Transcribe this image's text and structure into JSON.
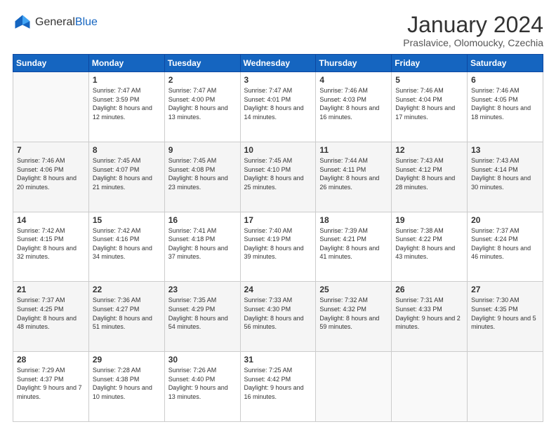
{
  "header": {
    "logo_general": "General",
    "logo_blue": "Blue",
    "month_title": "January 2024",
    "location": "Praslavice, Olomoucky, Czechia"
  },
  "weekdays": [
    "Sunday",
    "Monday",
    "Tuesday",
    "Wednesday",
    "Thursday",
    "Friday",
    "Saturday"
  ],
  "weeks": [
    [
      {
        "day": "",
        "sunrise": "",
        "sunset": "",
        "daylight": ""
      },
      {
        "day": "1",
        "sunrise": "Sunrise: 7:47 AM",
        "sunset": "Sunset: 3:59 PM",
        "daylight": "Daylight: 8 hours and 12 minutes."
      },
      {
        "day": "2",
        "sunrise": "Sunrise: 7:47 AM",
        "sunset": "Sunset: 4:00 PM",
        "daylight": "Daylight: 8 hours and 13 minutes."
      },
      {
        "day": "3",
        "sunrise": "Sunrise: 7:47 AM",
        "sunset": "Sunset: 4:01 PM",
        "daylight": "Daylight: 8 hours and 14 minutes."
      },
      {
        "day": "4",
        "sunrise": "Sunrise: 7:46 AM",
        "sunset": "Sunset: 4:03 PM",
        "daylight": "Daylight: 8 hours and 16 minutes."
      },
      {
        "day": "5",
        "sunrise": "Sunrise: 7:46 AM",
        "sunset": "Sunset: 4:04 PM",
        "daylight": "Daylight: 8 hours and 17 minutes."
      },
      {
        "day": "6",
        "sunrise": "Sunrise: 7:46 AM",
        "sunset": "Sunset: 4:05 PM",
        "daylight": "Daylight: 8 hours and 18 minutes."
      }
    ],
    [
      {
        "day": "7",
        "sunrise": "Sunrise: 7:46 AM",
        "sunset": "Sunset: 4:06 PM",
        "daylight": "Daylight: 8 hours and 20 minutes."
      },
      {
        "day": "8",
        "sunrise": "Sunrise: 7:45 AM",
        "sunset": "Sunset: 4:07 PM",
        "daylight": "Daylight: 8 hours and 21 minutes."
      },
      {
        "day": "9",
        "sunrise": "Sunrise: 7:45 AM",
        "sunset": "Sunset: 4:08 PM",
        "daylight": "Daylight: 8 hours and 23 minutes."
      },
      {
        "day": "10",
        "sunrise": "Sunrise: 7:45 AM",
        "sunset": "Sunset: 4:10 PM",
        "daylight": "Daylight: 8 hours and 25 minutes."
      },
      {
        "day": "11",
        "sunrise": "Sunrise: 7:44 AM",
        "sunset": "Sunset: 4:11 PM",
        "daylight": "Daylight: 8 hours and 26 minutes."
      },
      {
        "day": "12",
        "sunrise": "Sunrise: 7:43 AM",
        "sunset": "Sunset: 4:12 PM",
        "daylight": "Daylight: 8 hours and 28 minutes."
      },
      {
        "day": "13",
        "sunrise": "Sunrise: 7:43 AM",
        "sunset": "Sunset: 4:14 PM",
        "daylight": "Daylight: 8 hours and 30 minutes."
      }
    ],
    [
      {
        "day": "14",
        "sunrise": "Sunrise: 7:42 AM",
        "sunset": "Sunset: 4:15 PM",
        "daylight": "Daylight: 8 hours and 32 minutes."
      },
      {
        "day": "15",
        "sunrise": "Sunrise: 7:42 AM",
        "sunset": "Sunset: 4:16 PM",
        "daylight": "Daylight: 8 hours and 34 minutes."
      },
      {
        "day": "16",
        "sunrise": "Sunrise: 7:41 AM",
        "sunset": "Sunset: 4:18 PM",
        "daylight": "Daylight: 8 hours and 37 minutes."
      },
      {
        "day": "17",
        "sunrise": "Sunrise: 7:40 AM",
        "sunset": "Sunset: 4:19 PM",
        "daylight": "Daylight: 8 hours and 39 minutes."
      },
      {
        "day": "18",
        "sunrise": "Sunrise: 7:39 AM",
        "sunset": "Sunset: 4:21 PM",
        "daylight": "Daylight: 8 hours and 41 minutes."
      },
      {
        "day": "19",
        "sunrise": "Sunrise: 7:38 AM",
        "sunset": "Sunset: 4:22 PM",
        "daylight": "Daylight: 8 hours and 43 minutes."
      },
      {
        "day": "20",
        "sunrise": "Sunrise: 7:37 AM",
        "sunset": "Sunset: 4:24 PM",
        "daylight": "Daylight: 8 hours and 46 minutes."
      }
    ],
    [
      {
        "day": "21",
        "sunrise": "Sunrise: 7:37 AM",
        "sunset": "Sunset: 4:25 PM",
        "daylight": "Daylight: 8 hours and 48 minutes."
      },
      {
        "day": "22",
        "sunrise": "Sunrise: 7:36 AM",
        "sunset": "Sunset: 4:27 PM",
        "daylight": "Daylight: 8 hours and 51 minutes."
      },
      {
        "day": "23",
        "sunrise": "Sunrise: 7:35 AM",
        "sunset": "Sunset: 4:29 PM",
        "daylight": "Daylight: 8 hours and 54 minutes."
      },
      {
        "day": "24",
        "sunrise": "Sunrise: 7:33 AM",
        "sunset": "Sunset: 4:30 PM",
        "daylight": "Daylight: 8 hours and 56 minutes."
      },
      {
        "day": "25",
        "sunrise": "Sunrise: 7:32 AM",
        "sunset": "Sunset: 4:32 PM",
        "daylight": "Daylight: 8 hours and 59 minutes."
      },
      {
        "day": "26",
        "sunrise": "Sunrise: 7:31 AM",
        "sunset": "Sunset: 4:33 PM",
        "daylight": "Daylight: 9 hours and 2 minutes."
      },
      {
        "day": "27",
        "sunrise": "Sunrise: 7:30 AM",
        "sunset": "Sunset: 4:35 PM",
        "daylight": "Daylight: 9 hours and 5 minutes."
      }
    ],
    [
      {
        "day": "28",
        "sunrise": "Sunrise: 7:29 AM",
        "sunset": "Sunset: 4:37 PM",
        "daylight": "Daylight: 9 hours and 7 minutes."
      },
      {
        "day": "29",
        "sunrise": "Sunrise: 7:28 AM",
        "sunset": "Sunset: 4:38 PM",
        "daylight": "Daylight: 9 hours and 10 minutes."
      },
      {
        "day": "30",
        "sunrise": "Sunrise: 7:26 AM",
        "sunset": "Sunset: 4:40 PM",
        "daylight": "Daylight: 9 hours and 13 minutes."
      },
      {
        "day": "31",
        "sunrise": "Sunrise: 7:25 AM",
        "sunset": "Sunset: 4:42 PM",
        "daylight": "Daylight: 9 hours and 16 minutes."
      },
      {
        "day": "",
        "sunrise": "",
        "sunset": "",
        "daylight": ""
      },
      {
        "day": "",
        "sunrise": "",
        "sunset": "",
        "daylight": ""
      },
      {
        "day": "",
        "sunrise": "",
        "sunset": "",
        "daylight": ""
      }
    ]
  ]
}
